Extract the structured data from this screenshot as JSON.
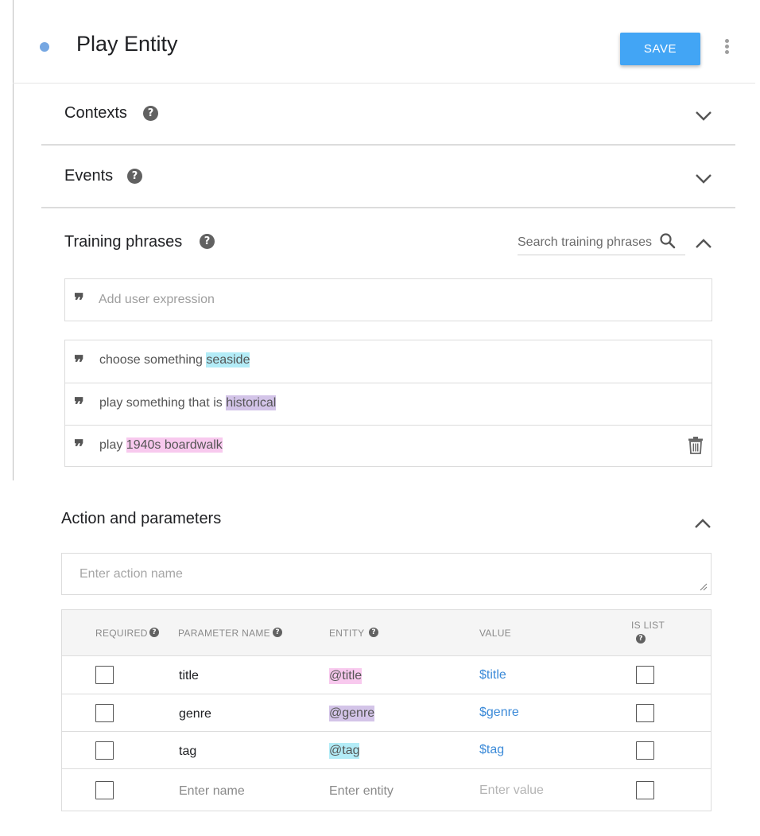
{
  "header": {
    "title": "Play Entity",
    "save_label": "SAVE"
  },
  "sections": {
    "contexts": {
      "title": "Contexts"
    },
    "events": {
      "title": "Events"
    },
    "training": {
      "title": "Training phrases",
      "search_placeholder": "Search training phrases",
      "add_placeholder": "Add user expression",
      "phrases": [
        {
          "prefix": "choose something ",
          "entity": "seaside",
          "color": "#b3ecf7"
        },
        {
          "prefix": "play something that is ",
          "entity": "historical",
          "color": "#d3c4e8"
        },
        {
          "prefix": "play ",
          "entity": "1940s boardwalk",
          "color": "#f8c9ee"
        }
      ]
    },
    "action": {
      "title": "Action and parameters",
      "action_placeholder": "Enter action name"
    }
  },
  "table": {
    "headers": {
      "required": "REQUIRED",
      "parameter_name": "PARAMETER NAME",
      "entity": "ENTITY",
      "value": "VALUE",
      "is_list": "IS LIST"
    },
    "rows": [
      {
        "name": "title",
        "entity": "@title",
        "value": "$title",
        "entity_color": "#f8c9ee"
      },
      {
        "name": "genre",
        "entity": "@genre",
        "value": "$genre",
        "entity_color": "#d3c4e8"
      },
      {
        "name": "tag",
        "entity": "@tag",
        "value": "$tag",
        "entity_color": "#b3ecf7"
      }
    ],
    "new_row": {
      "name_placeholder": "Enter name",
      "entity_placeholder": "Enter entity",
      "value_placeholder": "Enter value"
    }
  },
  "colors": {
    "accent": "#42a5f5",
    "status_dot": "#76a7e2",
    "value_link": "#3b8ad8"
  },
  "icons": {
    "status": "status-dot",
    "more": "more-vert-icon",
    "help": "help-circle-icon",
    "expand": "chevron-down-icon",
    "collapse": "chevron-up-icon",
    "search": "search-icon",
    "quote": "quote-icon",
    "delete": "trash-icon"
  }
}
